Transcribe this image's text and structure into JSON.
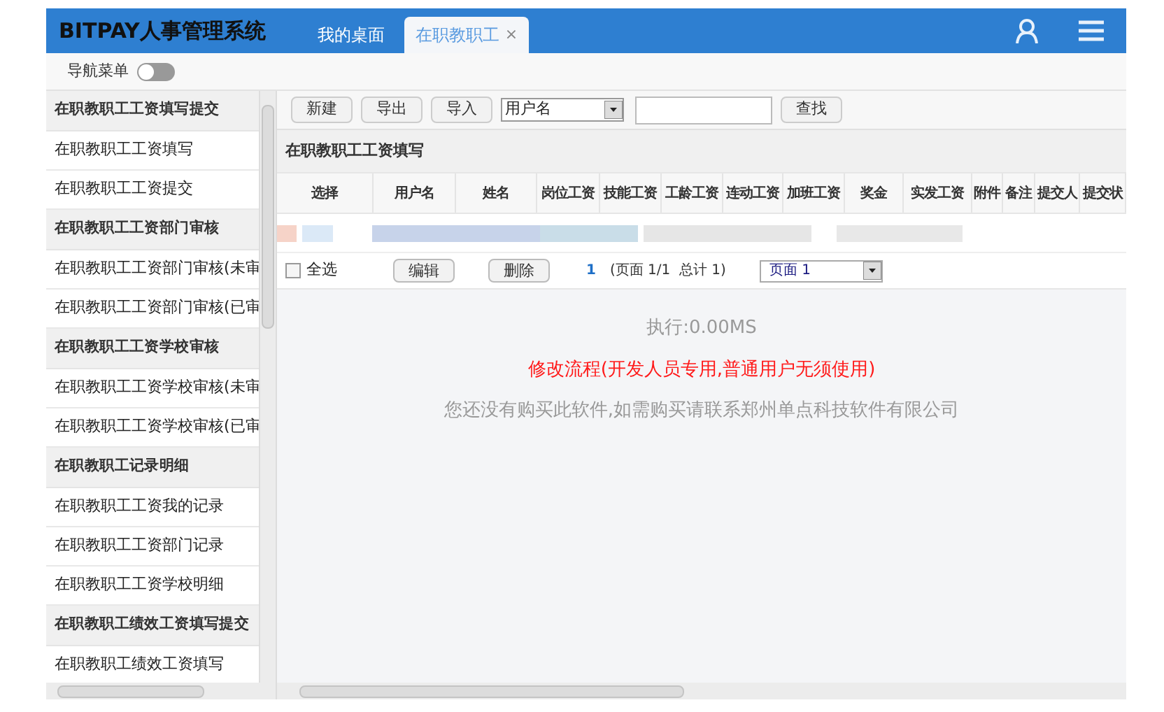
{
  "header": {
    "title": "BITPAY人事管理系统",
    "tabs": [
      {
        "label": "我的桌面",
        "selected": false
      },
      {
        "label": "在职教职工",
        "selected": true,
        "close": "×"
      }
    ]
  },
  "nav": {
    "label": "导航菜单",
    "on": false
  },
  "sidebar": {
    "groups": [
      {
        "title": "在职教职工工资填写提交",
        "items": [
          "在职教职工工资填写",
          "在职教职工工资提交"
        ]
      },
      {
        "title": "在职教职工工资部门审核",
        "items": [
          "在职教职工工资部门审核(未审",
          "在职教职工工资部门审核(已审"
        ]
      },
      {
        "title": "在职教职工工资学校审核",
        "items": [
          "在职教职工工资学校审核(未审",
          "在职教职工工资学校审核(已审"
        ]
      },
      {
        "title": "在职教职工记录明细",
        "items": [
          "在职教职工工资我的记录",
          "在职教职工工资部门记录",
          "在职教职工工资学校明细"
        ]
      },
      {
        "title": "在职教职工绩效工资填写提交",
        "items": [
          "在职教职工绩效工资填写"
        ]
      }
    ]
  },
  "toolbar": {
    "buttons": [
      "新建",
      "导出",
      "导入"
    ],
    "field_select": "用户名",
    "search_button": "查找"
  },
  "section_title": "在职教职工工资填写",
  "table": {
    "columns": [
      "选择",
      "用户名",
      "姓名",
      "岗位工资",
      "技能工资",
      "工龄工资",
      "连动工资",
      "加班工资",
      "奖金",
      "实发工资",
      "附件",
      "备注",
      "提交人",
      "提交状"
    ]
  },
  "footer": {
    "select_all": {
      "label": "全选",
      "checked": false
    },
    "buttons": [
      "编辑",
      "删除"
    ],
    "page_link": "1",
    "page_info": "(页面 1/1  总计 1)",
    "page_select": "页面 1"
  },
  "messages": [
    {
      "text": "执行:0.00MS",
      "kind": "info"
    },
    {
      "text": "修改流程(开发人员专用,普通用户无须使用)",
      "kind": "link"
    },
    {
      "text": "您还没有购买此软件,如需购买请联系郑州单点科技软件有限公司",
      "kind": "notice"
    }
  ]
}
